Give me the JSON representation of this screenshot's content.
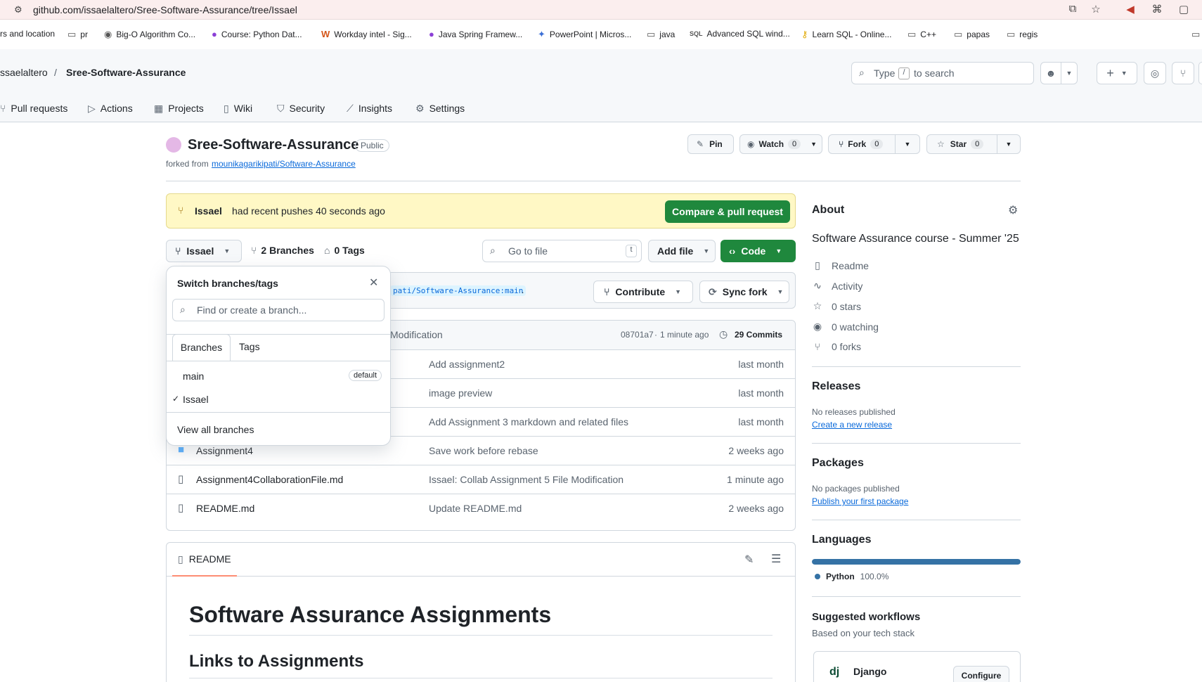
{
  "browser": {
    "url": "github.com/issaelaltero/Sree-Software-Assurance/tree/Issael",
    "bookmarks": [
      {
        "label": "rs and location",
        "icon": "none"
      },
      {
        "label": "pr",
        "icon": "folder-icon"
      },
      {
        "label": "Big-O Algorithm Co...",
        "icon": "globe-icon"
      },
      {
        "label": "Course: Python Dat...",
        "icon": "course-icon"
      },
      {
        "label": "Workday intel - Sig...",
        "icon": "workday-icon"
      },
      {
        "label": "Java Spring Framew...",
        "icon": "course-icon"
      },
      {
        "label": "PowerPoint | Micros...",
        "icon": "copilot-icon"
      },
      {
        "label": "java",
        "icon": "folder-icon"
      },
      {
        "label": "Advanced SQL wind...",
        "icon": "sql-icon"
      },
      {
        "label": "Learn SQL - Online...",
        "icon": "key-icon"
      },
      {
        "label": "C++",
        "icon": "folder-icon"
      },
      {
        "label": "papas",
        "icon": "folder-icon"
      },
      {
        "label": "regis",
        "icon": "folder-icon"
      }
    ]
  },
  "header": {
    "owner": "ssaelaltero",
    "separator": "/",
    "repo": "Sree-Software-Assurance",
    "search_prefix": "Type",
    "search_key": "/",
    "search_suffix": "to search",
    "nav": [
      {
        "label": "Pull requests",
        "icon": "pull-request-icon"
      },
      {
        "label": "Actions",
        "icon": "play-icon"
      },
      {
        "label": "Projects",
        "icon": "table-icon"
      },
      {
        "label": "Wiki",
        "icon": "book-icon"
      },
      {
        "label": "Security",
        "icon": "shield-icon"
      },
      {
        "label": "Insights",
        "icon": "graph-icon"
      },
      {
        "label": "Settings",
        "icon": "gear-icon"
      }
    ]
  },
  "repo": {
    "name": "Sree-Software-Assurance",
    "visibility": "Public",
    "forked_prefix": "forked from",
    "forked_from": "mounikagarikipati/Software-Assurance",
    "pin": "Pin",
    "watch": "Watch",
    "watch_count": "0",
    "fork": "Fork",
    "fork_count": "0",
    "star": "Star",
    "star_count": "0"
  },
  "banner": {
    "user": "Issael",
    "text": "had recent pushes 40 seconds ago",
    "button": "Compare & pull request"
  },
  "toolbar": {
    "branch": "Issael",
    "branches": "2 Branches",
    "tags": "0 Tags",
    "go_to_file": "Go to file",
    "go_to_file_key": "t",
    "add_file": "Add file",
    "code": "Code"
  },
  "sync_bar": {
    "fork_ref": "pati/Software-Assurance:main",
    "trailing": ".",
    "contribute": "Contribute",
    "sync": "Sync fork"
  },
  "commit_bar": {
    "message": "Modification",
    "hash": "08701a7",
    "sep": "·",
    "time": "1 minute ago",
    "commits": "29 Commits"
  },
  "files": [
    {
      "name": "",
      "icon": "none",
      "message": "Add assignment2",
      "date": "last month"
    },
    {
      "name": "",
      "icon": "none",
      "message": "image preview",
      "date": "last month"
    },
    {
      "name": "",
      "icon": "none",
      "message": "Add Assignment 3 markdown and related files",
      "date": "last month"
    },
    {
      "name": "Assignment4",
      "icon": "folder-icon",
      "message": "Save work before rebase",
      "date": "2 weeks ago"
    },
    {
      "name": "Assignment4CollaborationFile.md",
      "icon": "file-icon",
      "message": "Issael: Collab Assignment 5 File Modification",
      "date": "1 minute ago"
    },
    {
      "name": "README.md",
      "icon": "file-icon",
      "message": "Update README.md",
      "date": "2 weeks ago"
    }
  ],
  "dropdown": {
    "title": "Switch branches/tags",
    "placeholder": "Find or create a branch...",
    "tab_branches": "Branches",
    "tab_tags": "Tags",
    "branches": [
      {
        "name": "main",
        "badge": "default",
        "checked": false
      },
      {
        "name": "Issael",
        "badge": "",
        "checked": true
      }
    ],
    "check": "✓",
    "view_all": "View all branches"
  },
  "readme": {
    "tab": "README",
    "h1": "Software Assurance Assignments",
    "h2": "Links to Assignments"
  },
  "sidebar": {
    "about": "About",
    "description": "Software Assurance course - Summer '25",
    "items": [
      {
        "label": "Readme",
        "icon": "book-icon"
      },
      {
        "label": "Activity",
        "icon": "pulse-icon"
      },
      {
        "label": "0 stars",
        "icon": "star-icon"
      },
      {
        "label": "0 watching",
        "icon": "eye-icon"
      },
      {
        "label": "0 forks",
        "icon": "fork-icon"
      }
    ],
    "releases": "Releases",
    "releases_none": "No releases published",
    "releases_link": "Create a new release",
    "packages": "Packages",
    "packages_none": "No packages published",
    "packages_link": "Publish your first package",
    "languages": "Languages",
    "language_name": "Python",
    "language_pct": "100.0%",
    "language_share": 1.0,
    "language_color": "#3572A5",
    "suggested": "Suggested workflows",
    "suggested_sub": "Based on your tech stack",
    "workflow_name": "Django",
    "workflow_logo": "dj",
    "workflow_button": "Configure"
  },
  "colors": {
    "accent_green": "#1f883d",
    "link_blue": "#0969da",
    "banner_bg": "#fff8c5"
  }
}
